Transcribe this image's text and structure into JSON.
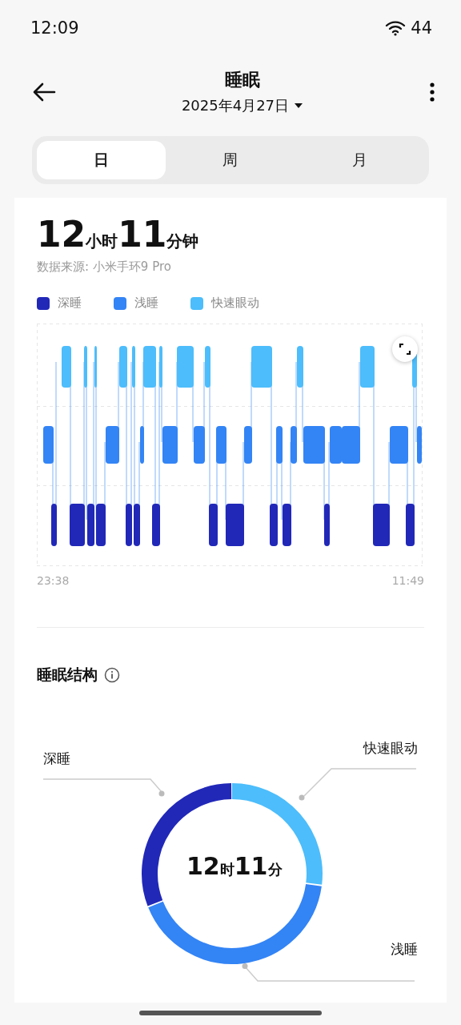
{
  "status_bar": {
    "time": "12:09",
    "battery": "44"
  },
  "header": {
    "title": "睡眠",
    "date": "2025年4月27日"
  },
  "tabs": [
    {
      "label": "日",
      "selected": true
    },
    {
      "label": "周",
      "selected": false
    },
    {
      "label": "月",
      "selected": false
    }
  ],
  "summary": {
    "hours": "12",
    "hours_unit": "小时",
    "minutes": "11",
    "minutes_unit": "分钟",
    "source": "数据来源: 小米手环9 Pro"
  },
  "legend": [
    {
      "label": "深睡",
      "color": "#2128b8"
    },
    {
      "label": "浅睡",
      "color": "#3384f5"
    },
    {
      "label": "快速眼动",
      "color": "#4dbdfb"
    }
  ],
  "hypnogram": {
    "start_time": "23:38",
    "end_time": "11:49"
  },
  "structure": {
    "title": "睡眠结构",
    "center": {
      "hours": "12",
      "hours_unit": "时",
      "minutes": "11",
      "minutes_unit": "分"
    },
    "labels": [
      {
        "label": "深睡"
      },
      {
        "label": "快速眼动"
      },
      {
        "label": "浅睡"
      }
    ]
  }
}
